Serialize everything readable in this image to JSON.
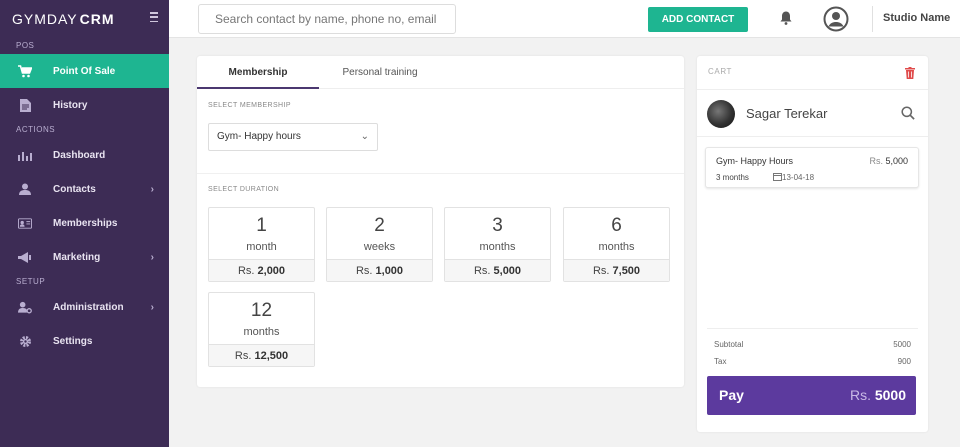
{
  "brand": {
    "light": "GYMDAY",
    "bold": "CRM"
  },
  "sidebar": {
    "sections": {
      "pos": "POS",
      "actions": "ACTIONS",
      "setup": "SETUP"
    },
    "items": [
      {
        "label": "Point Of Sale",
        "icon": "cart-icon",
        "active": true
      },
      {
        "label": "History",
        "icon": "document-icon"
      },
      {
        "label": "Dashboard",
        "icon": "bar-chart-icon"
      },
      {
        "label": "Contacts",
        "icon": "person-icon",
        "chevron": true
      },
      {
        "label": "Memberships",
        "icon": "id-card-icon"
      },
      {
        "label": "Marketing",
        "icon": "megaphone-icon",
        "chevron": true
      },
      {
        "label": "Administration",
        "icon": "user-cog-icon",
        "chevron": true
      },
      {
        "label": "Settings",
        "icon": "gear-icon"
      }
    ]
  },
  "topbar": {
    "search_placeholder": "Search contact by name, phone no, email",
    "add_contact": "ADD CONTACT",
    "studio_name": "Studio Name"
  },
  "main": {
    "tabs": [
      {
        "label": "Membership",
        "active": true
      },
      {
        "label": "Personal training"
      }
    ],
    "select_membership_label": "SELECT MEMBERSHIP",
    "selected_membership": "Gym- Happy hours",
    "select_duration_label": "SELECT DURATION",
    "durations": [
      {
        "number": "1",
        "unit": "month",
        "currency": "Rs.",
        "price": "2,000"
      },
      {
        "number": "2",
        "unit": "weeks",
        "currency": "Rs.",
        "price": "1,000"
      },
      {
        "number": "3",
        "unit": "months",
        "currency": "Rs.",
        "price": "5,000"
      },
      {
        "number": "6",
        "unit": "months",
        "currency": "Rs.",
        "price": "7,500"
      },
      {
        "number": "12",
        "unit": "months",
        "currency": "Rs.",
        "price": "12,500"
      }
    ]
  },
  "cart": {
    "title": "CART",
    "customer_name": "Sagar Terekar",
    "item": {
      "name": "Gym- Happy Hours",
      "currency": "Rs.",
      "price": "5,000",
      "duration": "3 months",
      "date": "13-04-18"
    },
    "subtotal_label": "Subtotal",
    "subtotal_value": "5000",
    "tax_label": "Tax",
    "tax_value": "900",
    "pay_label": "Pay",
    "pay_currency": "Rs.",
    "pay_amount": "5000"
  },
  "colors": {
    "sidebar_bg": "#3d2c55",
    "accent_green": "#1eb591",
    "pay_purple": "#5c3a9e",
    "trash_red": "#e04b4b"
  }
}
